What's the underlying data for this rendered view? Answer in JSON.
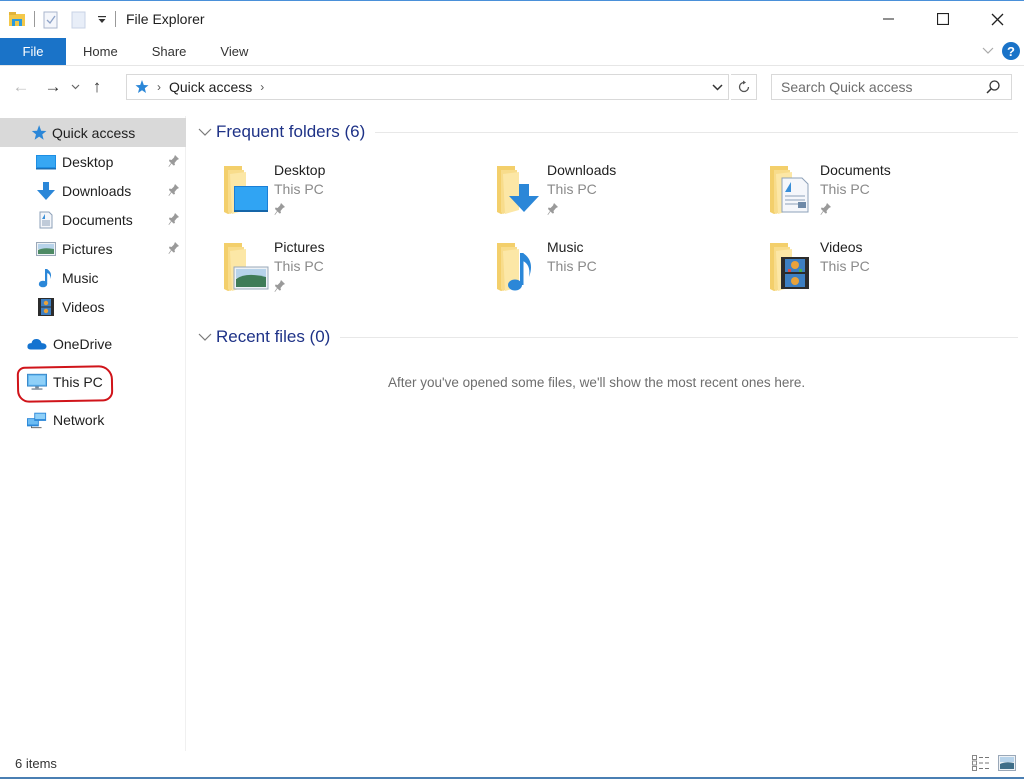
{
  "window": {
    "title": "File Explorer",
    "controls": {
      "minimize": "—",
      "maximize": "☐",
      "close": "✕"
    }
  },
  "ribbon": {
    "tabs": [
      {
        "label": "File",
        "active": true
      },
      {
        "label": "Home"
      },
      {
        "label": "Share"
      },
      {
        "label": "View"
      }
    ],
    "help_label": "?",
    "accent": "#1a73c8"
  },
  "navbar": {
    "back": "←",
    "forward": "→",
    "recent": "⌄",
    "up": "↑",
    "breadcrumb": [
      "Quick access"
    ],
    "search_placeholder": "Search Quick access"
  },
  "sidebar": {
    "items": [
      {
        "label": "Quick access",
        "icon": "star-icon",
        "selected": true
      },
      {
        "label": "Desktop",
        "icon": "desktop-icon",
        "pinned": true
      },
      {
        "label": "Downloads",
        "icon": "download-icon",
        "pinned": true
      },
      {
        "label": "Documents",
        "icon": "document-icon",
        "pinned": true
      },
      {
        "label": "Pictures",
        "icon": "pictures-icon",
        "pinned": true
      },
      {
        "label": "Music",
        "icon": "music-icon"
      },
      {
        "label": "Videos",
        "icon": "videos-icon"
      },
      {
        "label": "OneDrive",
        "icon": "cloud-icon"
      },
      {
        "label": "This PC",
        "icon": "computer-icon",
        "annotated": true
      },
      {
        "label": "Network",
        "icon": "network-icon"
      }
    ]
  },
  "main": {
    "frequent_header": "Frequent folders (6)",
    "folders": [
      {
        "name": "Desktop",
        "location": "This PC",
        "pinned": true
      },
      {
        "name": "Downloads",
        "location": "This PC",
        "pinned": true
      },
      {
        "name": "Documents",
        "location": "This PC",
        "pinned": true
      },
      {
        "name": "Pictures",
        "location": "This PC",
        "pinned": true
      },
      {
        "name": "Music",
        "location": "This PC",
        "pinned": false
      },
      {
        "name": "Videos",
        "location": "This PC",
        "pinned": false
      }
    ],
    "recent_header": "Recent files (0)",
    "recent_empty": "After you've opened some files, we'll show the most recent ones here."
  },
  "status": {
    "items_count": "6 items"
  },
  "annotation_color": "#d0141a"
}
